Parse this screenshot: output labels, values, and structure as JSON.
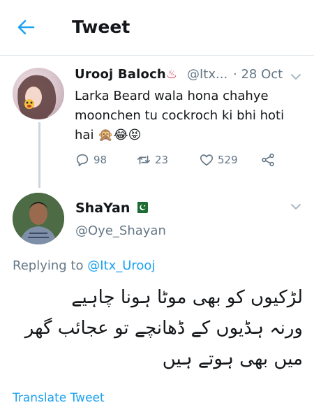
{
  "header": {
    "title": "Tweet"
  },
  "original_tweet": {
    "display_name": "Urooj Baloch",
    "name_emoji": "♨",
    "handle": "@Itx...",
    "date": "· 28 Oct",
    "text_lines": [
      "Larka Beard wala hona chahye",
      "moonchen tu cockroch ki bhi hoti",
      "hai 🙊😂😝"
    ],
    "reply_count": "98",
    "retweet_count": "23",
    "like_count": "529"
  },
  "reply_tweet": {
    "display_name": "ShaYan",
    "handle": "@Oye_Shayan",
    "replying_prefix": "Replying to",
    "replying_to": "@Itx_Urooj",
    "text_lines": [
      "لڑکیوں کو بھی موٹا ہونا چاہیے",
      "ورنہ ہڈیوں کے ڈھانچے تو عجائب گھر",
      "میں بھی ہوتے ہیں"
    ],
    "translate_label": "Translate Tweet"
  },
  "colors": {
    "accent": "#1da1f2",
    "muted": "#657786",
    "text": "#14171a"
  }
}
